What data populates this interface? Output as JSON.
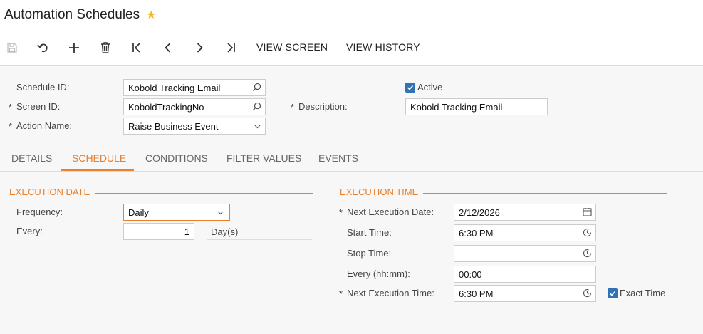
{
  "page": {
    "title": "Automation Schedules"
  },
  "toolbar": {
    "view_screen": "VIEW SCREEN",
    "view_history": "VIEW HISTORY"
  },
  "form": {
    "schedule_id_label": "Schedule ID:",
    "schedule_id_value": "Kobold Tracking Email",
    "screen_id_label": "Screen ID:",
    "screen_id_value": "KoboldTrackingNo",
    "action_name_label": "Action Name:",
    "action_name_value": "Raise Business Event",
    "active_label": "Active",
    "description_label": "Description:",
    "description_value": "Kobold Tracking Email",
    "required_mark": "*"
  },
  "tabs": [
    "DETAILS",
    "SCHEDULE",
    "CONDITIONS",
    "FILTER VALUES",
    "EVENTS"
  ],
  "execution_date": {
    "title": "EXECUTION DATE",
    "frequency_label": "Frequency:",
    "frequency_value": "Daily",
    "every_label": "Every:",
    "every_value": "1",
    "every_unit": "Day(s)"
  },
  "execution_time": {
    "title": "EXECUTION TIME",
    "next_date_label": "Next Execution Date:",
    "next_date_value": "2/12/2026",
    "start_time_label": "Start Time:",
    "start_time_value": "6:30 PM",
    "stop_time_label": "Stop Time:",
    "stop_time_value": "",
    "every_label": "Every (hh:mm):",
    "every_value": "00:00",
    "next_time_label": "Next Execution Time:",
    "next_time_value": "6:30 PM",
    "exact_time_label": "Exact Time"
  },
  "colors": {
    "accent": "#e8802e",
    "checkbox": "#2f73b6",
    "star": "#f3b52a"
  }
}
